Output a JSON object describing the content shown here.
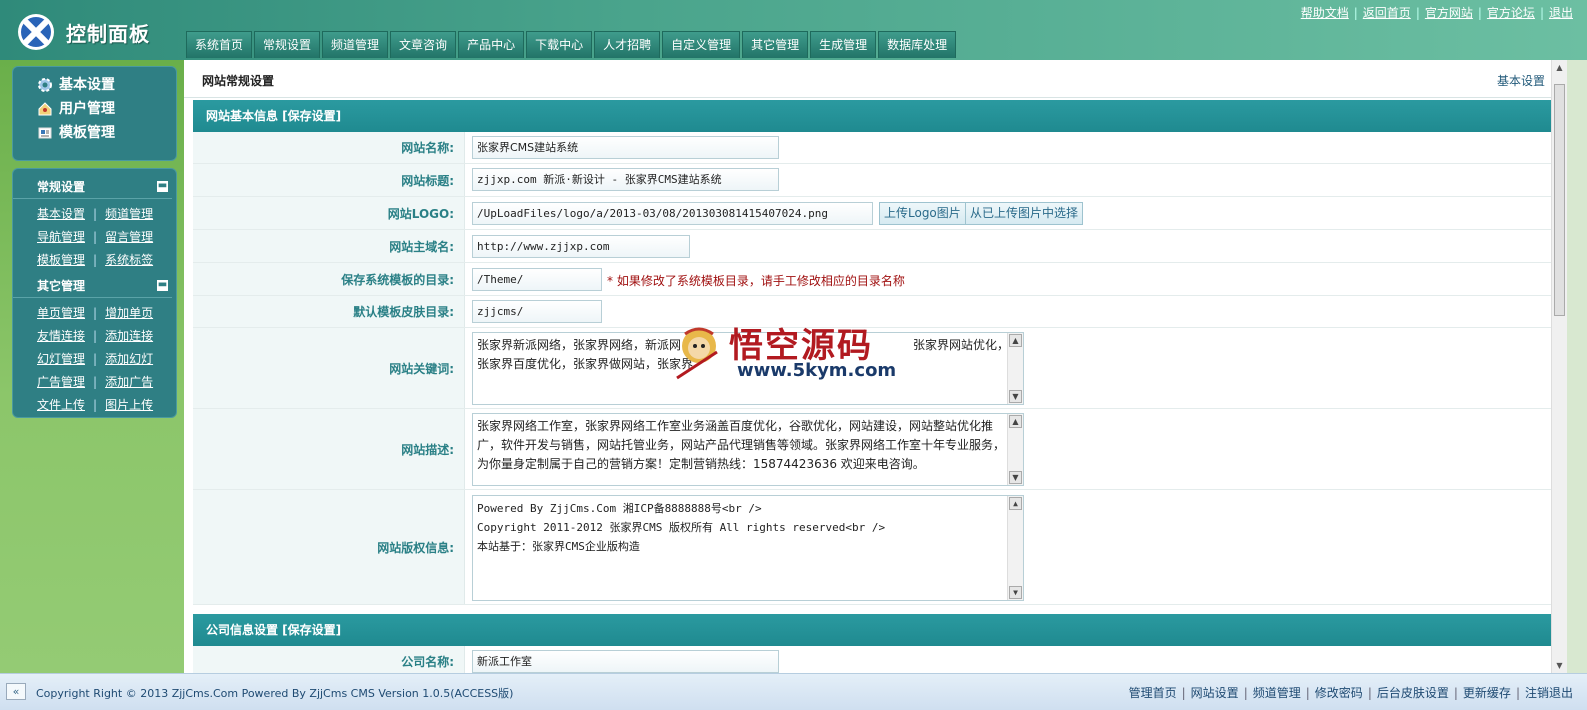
{
  "header": {
    "title": "控制面板",
    "top_links": [
      "帮助文档",
      "返回首页",
      "官方网站",
      "官方论坛",
      "退出"
    ],
    "nav_tabs": [
      "系统首页",
      "常规设置",
      "频道管理",
      "文章咨询",
      "产品中心",
      "下载中心",
      "人才招聘",
      "自定义管理",
      "其它管理",
      "生成管理",
      "数据库处理"
    ]
  },
  "sidebar": {
    "quick": [
      {
        "icon": "gear-icon",
        "label": "基本设置"
      },
      {
        "icon": "user-icon",
        "label": "用户管理"
      },
      {
        "icon": "template-icon",
        "label": "模板管理"
      }
    ],
    "groups": [
      {
        "title": "常规设置",
        "rows": [
          [
            "基本设置",
            "频道管理"
          ],
          [
            "导航管理",
            "留言管理"
          ],
          [
            "模板管理",
            "系统标签"
          ]
        ]
      },
      {
        "title": "其它管理",
        "rows": [
          [
            "单页管理",
            "增加单页"
          ],
          [
            "友情连接",
            "添加连接"
          ],
          [
            "幻灯管理",
            "添加幻灯"
          ],
          [
            "广告管理",
            "添加广告"
          ],
          [
            "文件上传",
            "图片上传"
          ]
        ]
      }
    ]
  },
  "page": {
    "title": "网站常规设置",
    "crumb": "基本设置"
  },
  "section_basic": {
    "title": "网站基本信息 [保存设置]",
    "site_name_label": "网站名称:",
    "site_name_value": "张家界CMS建站系统",
    "site_title_label": "网站标题:",
    "site_title_value": "zjjxp.com 新派·新设计 - 张家界CMS建站系统",
    "logo_label": "网站LOGO:",
    "logo_value": "/UpLoadFiles/logo/a/2013-03/08/201303081415407024.png",
    "upload_logo_button": "上传Logo图片",
    "choose_uploaded_button": "从已上传图片中选择",
    "domain_label": "网站主域名:",
    "domain_value": "http://www.zjjxp.com",
    "theme_dir_label": "保存系统模板的目录:",
    "theme_dir_value": "/Theme/",
    "theme_dir_note": "* 如果修改了系统模板目录，请手工修改相应的目录名称",
    "skin_dir_label": "默认模板皮肤目录:",
    "skin_dir_value": "zjjcms/",
    "keywords_label": "网站关键词:",
    "keywords_lines": [
      "张家界新派网络，张家界网络，新派网",
      "张家界百度优化，张家界做网站，张家界"
    ],
    "keywords_tail": "张家界网站优化，张",
    "description_label": "网站描述:",
    "description_lines": [
      "张家界网络工作室，张家界网络工作室业务涵盖百度优化，谷歌优化，网站建设，网站整站优化推",
      "广，软件开发与销售，网站托管业务，网站产品代理销售等领域。张家界网络工作室十年专业服务，",
      "为你量身定制属于自己的营销方案！定制营销热线：15874423636 欢迎来电咨询。"
    ],
    "copyright_label": "网站版权信息:",
    "copyright_lines": [
      "Powered By ZjjCms.Com 湘ICP备8888888号<br />",
      "Copyright 2011-2012 张家界CMS 版权所有 All rights reserved<br />",
      "本站基于：张家界CMS企业版构造"
    ]
  },
  "section_company": {
    "title": "公司信息设置 [保存设置]",
    "company_name_label": "公司名称:",
    "company_name_value": "新派工作室"
  },
  "watermark": {
    "text": "悟空源码",
    "url": "www.5kym.com"
  },
  "footer": {
    "copyright": "Copyright Right © 2013 ZjjCms.Com Powered By ZjjCms CMS Version 1.0.5(ACCESS版)",
    "links": [
      "管理首页",
      "网站设置",
      "频道管理",
      "修改密码",
      "后台皮肤设置",
      "更新缓存",
      "注销退出"
    ]
  }
}
